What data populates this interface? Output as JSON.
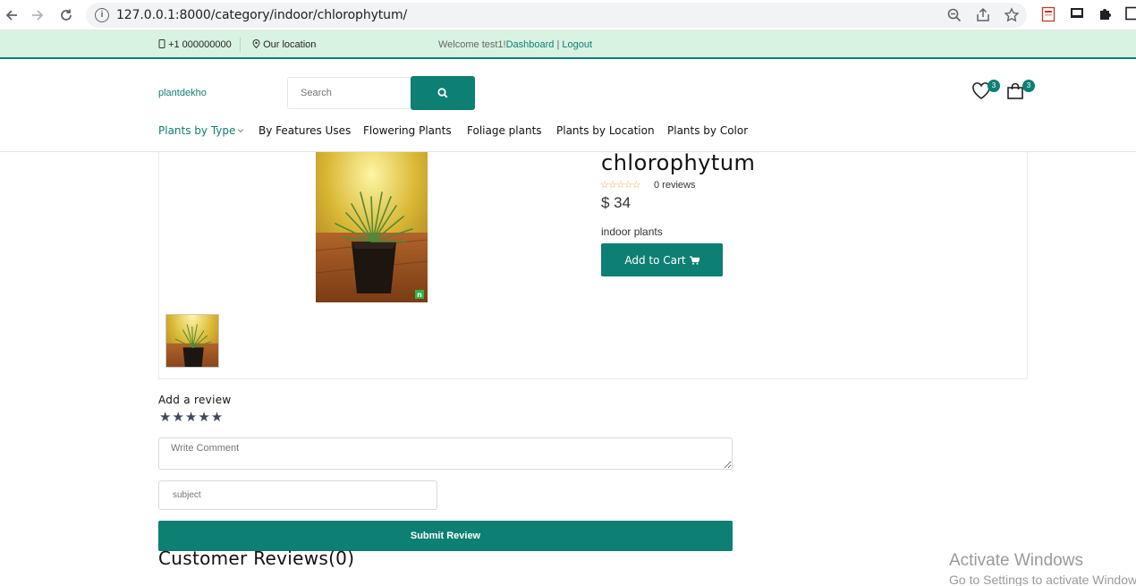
{
  "browser": {
    "url": "127.0.0.1:8000/category/indoor/chlorophytum/"
  },
  "topbar": {
    "phone": "+1 000000000",
    "location": "Our location",
    "welcome": "Welcome test1!",
    "dashboard": "Dashboard",
    "separator": " | ",
    "logout": "Logout"
  },
  "header": {
    "logo": "plantdekho",
    "search_placeholder": "Search",
    "wishlist_count": "3",
    "cart_count": "3"
  },
  "menu": {
    "items": [
      {
        "label": "Plants by Type",
        "active": true,
        "has_dropdown": true
      },
      {
        "label": "By Features Uses"
      },
      {
        "label": "Flowering Plants"
      },
      {
        "label": "Foliage plants"
      },
      {
        "label": "Plants by Location"
      },
      {
        "label": "Plants by Color"
      }
    ]
  },
  "product": {
    "title": "chlorophytum",
    "rating_stars": "☆☆☆☆☆",
    "reviews": "0 reviews",
    "price": "$ 34",
    "category": "indoor plants",
    "add_to_cart": "Add to Cart"
  },
  "review_form": {
    "heading": "Add a review",
    "stars": "★★★★★",
    "comment_placeholder": "Write Comment",
    "subject_placeholder": "subject",
    "submit": "Submit Review"
  },
  "customer_reviews": {
    "heading": "Customer Reviews(0)"
  },
  "watermark": {
    "line1": "Activate Windows",
    "line2": "Go to Settings to activate Windows."
  }
}
